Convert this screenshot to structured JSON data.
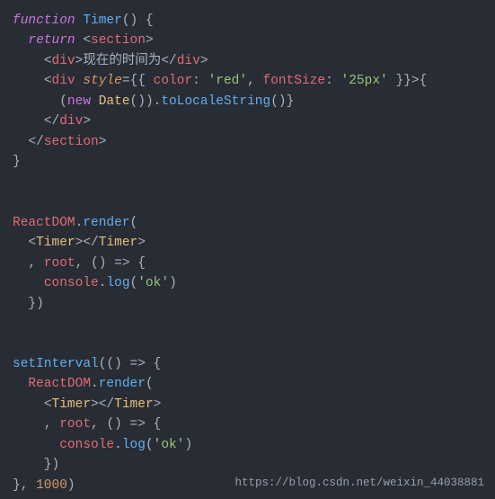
{
  "code": {
    "line1": {
      "kw_function": "function",
      "fn_name": "Timer",
      "parens": "()",
      "brace": " {"
    },
    "line2": {
      "kw_return": "return",
      "open_section": "<section>"
    },
    "line3": {
      "open_div": "<div>",
      "text": "现在的时间为",
      "close_div": "</div>"
    },
    "line4": {
      "open_div": "<div ",
      "attr_style": "style",
      "eq_braces": "={{ ",
      "prop_color": "color",
      "colon1": ": ",
      "val_red": "'red'",
      "comma1": ", ",
      "prop_fontSize": "fontSize",
      "colon2": ": ",
      "val_25px": "'25px'",
      "close_braces": " }}",
      "gt": ">",
      "brace_open": "{"
    },
    "line5": {
      "paren_open": "(",
      "kw_new": "new",
      "sp": " ",
      "class_Date": "Date",
      "call": "()",
      "paren_close": ")",
      "dot": ".",
      "method": "toLocaleString",
      "call2": "()",
      "brace_close": "}"
    },
    "line6": {
      "close_div": "</div>"
    },
    "line7": {
      "close_section": "</section>"
    },
    "line8": {
      "brace": "}"
    },
    "line9": {
      "obj": "ReactDOM",
      "dot": ".",
      "method": "render",
      "paren": "("
    },
    "line10": {
      "open_timer": "<Timer>",
      "close_timer": "</Timer>"
    },
    "line11": {
      "comma": ", ",
      "var_root": "root",
      "comma2": ", ",
      "arrow": "() => {"
    },
    "line12": {
      "obj": "console",
      "dot": ".",
      "method": "log",
      "paren_open": "(",
      "str": "'ok'",
      "paren_close": ")"
    },
    "line13": {
      "close": "})"
    },
    "line14": {
      "fn": "setInterval",
      "paren": "(",
      "arrow": "() => {"
    },
    "line15": {
      "obj": "ReactDOM",
      "dot": ".",
      "method": "render",
      "paren": "("
    },
    "line16": {
      "open_timer": "<Timer>",
      "close_timer": "</Timer>"
    },
    "line17": {
      "comma": ", ",
      "var_root": "root",
      "comma2": ", ",
      "arrow": "() => {"
    },
    "line18": {
      "obj": "console",
      "dot": ".",
      "method": "log",
      "paren_open": "(",
      "str": "'ok'",
      "paren_close": ")"
    },
    "line19": {
      "close": "})"
    },
    "line20": {
      "brace": "}, ",
      "num": "1000",
      "paren": ")"
    }
  },
  "watermark": "https://blog.csdn.net/weixin_44038881"
}
